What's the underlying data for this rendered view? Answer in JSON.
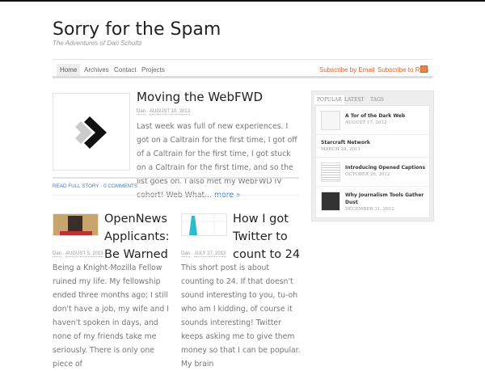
{
  "site": {
    "title": "Sorry for the Spam",
    "tagline": "The Adventures of Dan Schultz"
  },
  "nav": {
    "items": [
      "Home",
      "Archives",
      "Contact",
      "Projects"
    ],
    "subscribe_email": "Subscribe by Email",
    "subscribe_rss": "Subscribe to RSS"
  },
  "featured": {
    "title": "Moving the WebFWD",
    "author": "Dan",
    "date": "AUGUST 10, 2013",
    "excerpt": "Last week was full of new experiences. I got on a Caltrain for the first time, I got off of a Caltrain for the first time, I got stuck on a Caltrain for the first time, and so the list goes on. I also met my WebFWD IV cohort! Web What...",
    "more": "more »",
    "read_full": "READ FULL STORY",
    "comments": "0 COMMENTS"
  },
  "posts": [
    {
      "title": "OpenNews Applicants: Be Warned",
      "author": "Dan",
      "date": "AUGUST 5, 2013",
      "excerpt": "Being a Knight-Mozilla Fellow ruined my life. My fellowship ended three months ago; I still don't have a job, my wife and I haven't spoken in days, and none of my friends take me seriously. There is only one piece of"
    },
    {
      "title": "How I got Twitter to count to 24",
      "author": "Dan",
      "date": "JULY 27, 2013",
      "excerpt": "This short post is about counting to 24. If that doesn't sound interesting to you, tu-oh who am I kidding, of course it sounds interesting! Twitter keeps asking me to give them money so that I can be popular. My brain"
    }
  ],
  "sidebar": {
    "tabs": [
      "POPULAR",
      "LATEST",
      "TAGS"
    ],
    "items": [
      {
        "title": "A Tor of the Dark Web",
        "date": "AUGUST 17, 2012"
      },
      {
        "title": "Starcraft Network",
        "date": "MARCH 28, 2011"
      },
      {
        "title": "Introducing Opened Captions",
        "date": "OCTOBER 26, 2012"
      },
      {
        "title": "Why Journalism Tools Gather Dust",
        "date": "DECEMBER 31, 2012"
      }
    ]
  },
  "colors": {
    "accent": "#d0642a",
    "link": "#3a7fc9"
  }
}
